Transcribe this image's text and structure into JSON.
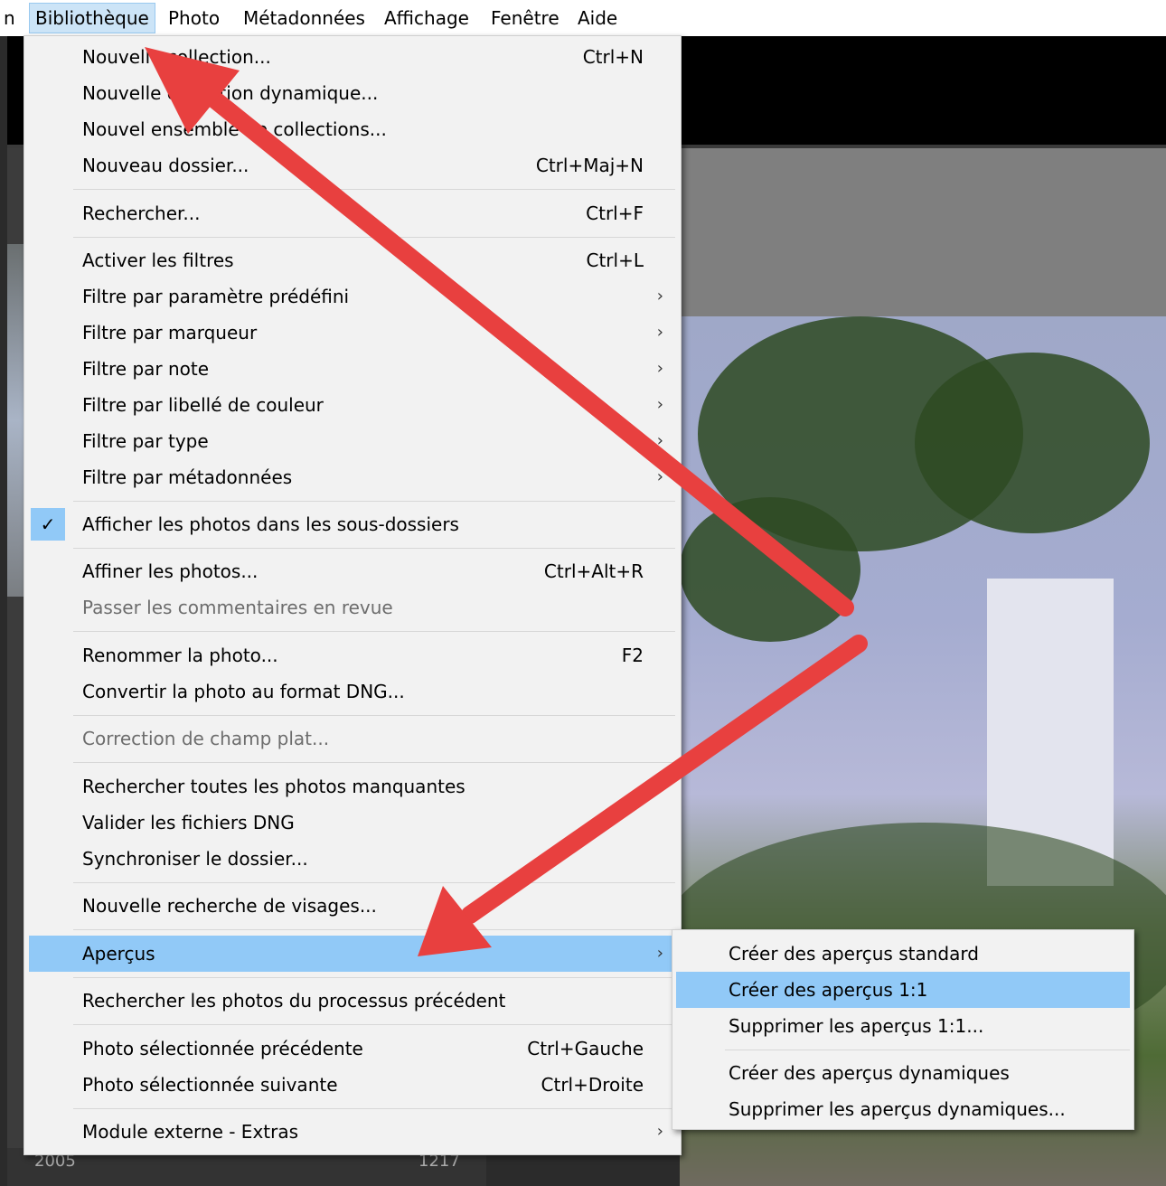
{
  "menubar": {
    "left_fragment": "n",
    "items": [
      "Bibliothèque",
      "Photo",
      "Métadonnées",
      "Affichage",
      "Fenêtre",
      "Aide"
    ]
  },
  "menu": {
    "items": [
      {
        "label": "Nouvelle collection...",
        "shortcut": "Ctrl+N"
      },
      {
        "label": "Nouvelle collection dynamique..."
      },
      {
        "label": "Nouvel ensemble de collections..."
      },
      {
        "label": "Nouveau dossier...",
        "shortcut": "Ctrl+Maj+N"
      },
      {
        "label": "Rechercher...",
        "shortcut": "Ctrl+F"
      },
      {
        "label": "Activer les filtres",
        "shortcut": "Ctrl+L"
      },
      {
        "label": "Filtre par paramètre prédéfini",
        "submenu": true
      },
      {
        "label": "Filtre par marqueur",
        "submenu": true
      },
      {
        "label": "Filtre par note",
        "submenu": true
      },
      {
        "label": "Filtre par libellé de couleur",
        "submenu": true
      },
      {
        "label": "Filtre par type",
        "submenu": true
      },
      {
        "label": "Filtre par métadonnées",
        "submenu": true
      },
      {
        "label": "Afficher les photos dans les sous-dossiers",
        "checked": true
      },
      {
        "label": "Affiner les photos...",
        "shortcut": "Ctrl+Alt+R"
      },
      {
        "label": "Passer les commentaires en revue",
        "disabled": true
      },
      {
        "label": "Renommer la photo...",
        "shortcut": "F2"
      },
      {
        "label": "Convertir la photo au format DNG..."
      },
      {
        "label": "Correction de champ plat...",
        "disabled": true
      },
      {
        "label": "Rechercher toutes les photos manquantes"
      },
      {
        "label": "Valider les fichiers DNG"
      },
      {
        "label": "Synchroniser le dossier..."
      },
      {
        "label": "Nouvelle recherche de visages..."
      },
      {
        "label": "Aperçus",
        "submenu": true,
        "highlighted": true
      },
      {
        "label": "Rechercher les photos du processus précédent"
      },
      {
        "label": "Photo sélectionnée précédente",
        "shortcut": "Ctrl+Gauche"
      },
      {
        "label": "Photo sélectionnée suivante",
        "shortcut": "Ctrl+Droite"
      },
      {
        "label": "Module externe - Extras",
        "submenu": true
      }
    ],
    "submenu_glyph": "›",
    "check_glyph": "✓"
  },
  "submenu": {
    "items": [
      {
        "label": "Créer des aperçus standard"
      },
      {
        "label": "Créer des aperçus 1:1",
        "highlighted": true
      },
      {
        "label": "Supprimer les aperçus 1:1..."
      },
      {
        "label": "Créer des aperçus dynamiques"
      },
      {
        "label": "Supprimer les aperçus dynamiques..."
      }
    ]
  },
  "background": {
    "panel_year": "2005",
    "panel_count": "1217"
  },
  "colors": {
    "menu_bg": "#f2f2f2",
    "highlight": "#91c9f7",
    "menubar_active": "#cce4f7",
    "annotation_arrow": "#e8403f"
  },
  "icons": [
    "checkmark-icon",
    "submenu-chevron-icon",
    "annotation-arrow-icon"
  ]
}
